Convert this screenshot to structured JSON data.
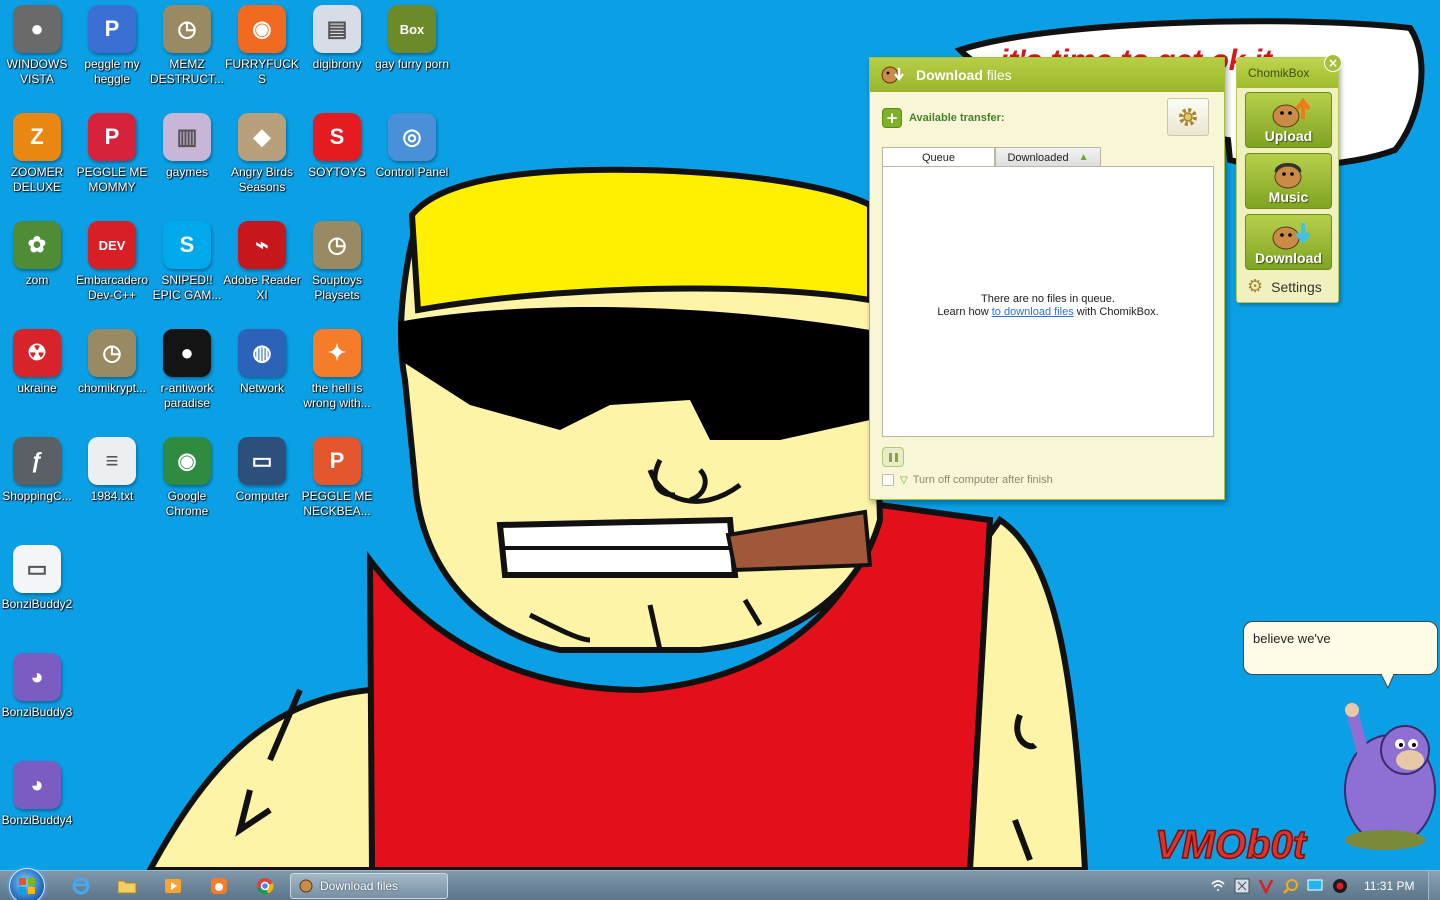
{
  "desktop_icons": [
    {
      "label": "WINDOWS VISTA",
      "icon": "windows-vista-app-icon",
      "color": "#6a6a6a",
      "glyph": "●"
    },
    {
      "label": "peggle my heggle",
      "icon": "peggle-icon",
      "color": "#3b6fd4",
      "glyph": "P"
    },
    {
      "label": "MEMZ DESTRUCT...",
      "icon": "clock-app-icon",
      "color": "#9a8a63",
      "glyph": "◷"
    },
    {
      "label": "FURRYFUCKS",
      "icon": "firefox-icon",
      "color": "#f06a1f",
      "glyph": "◉"
    },
    {
      "label": "digibrony",
      "icon": "document-app-icon",
      "color": "#d7dce6",
      "glyph": "▤"
    },
    {
      "label": "gay furry porn",
      "icon": "chomikbox-icon",
      "color": "#6c8a2a",
      "glyph": "Box"
    },
    {
      "label": "ZOOMER DELUXE",
      "icon": "zoomer-icon",
      "color": "#e88712",
      "glyph": "Z"
    },
    {
      "label": "PEGGLE ME MOMMY",
      "icon": "peggle-icon",
      "color": "#d6223a",
      "glyph": "P"
    },
    {
      "label": "gaymes",
      "icon": "folder-icon",
      "color": "#c7b6d8",
      "glyph": "▥"
    },
    {
      "label": "Angry Birds Seasons",
      "icon": "angry-birds-icon",
      "color": "#b9a07d",
      "glyph": "◆"
    },
    {
      "label": "SOYTOYS",
      "icon": "soytoys-icon",
      "color": "#e61b22",
      "glyph": "S"
    },
    {
      "label": "Control Panel",
      "icon": "control-panel-icon",
      "color": "#4a90d9",
      "glyph": "◎"
    },
    {
      "label": "zom",
      "icon": "plant-icon",
      "color": "#4f8c35",
      "glyph": "✿"
    },
    {
      "label": "Embarcadero Dev-C++",
      "icon": "dev-cpp-icon",
      "color": "#d81f26",
      "glyph": "DEV"
    },
    {
      "label": "SNIPED!! EPIC GAM...",
      "icon": "skype-icon",
      "color": "#00a9ec",
      "glyph": "S"
    },
    {
      "label": "Adobe Reader XI",
      "icon": "adobe-reader-icon",
      "color": "#c8161d",
      "glyph": "⌁"
    },
    {
      "label": "Souptoys Playsets",
      "icon": "clock-app-icon",
      "color": "#9a8a63",
      "glyph": "◷"
    },
    {
      "label": "ukraine",
      "icon": "radiation-icon",
      "color": "#d9232a",
      "glyph": "☢"
    },
    {
      "label": "chomikrypt...",
      "icon": "clock-app-icon",
      "color": "#9a8a63",
      "glyph": "◷"
    },
    {
      "label": "r-antiwork paradise",
      "icon": "antiwork-icon",
      "color": "#141414",
      "glyph": "●"
    },
    {
      "label": "Network",
      "icon": "network-icon",
      "color": "#2a63b7",
      "glyph": "◍"
    },
    {
      "label": "the hell is wrong with...",
      "icon": "uc-browser-icon",
      "color": "#f57c28",
      "glyph": "✦"
    },
    {
      "label": "ShoppingC...",
      "icon": "flash-icon",
      "color": "#5a6066",
      "glyph": "ƒ"
    },
    {
      "label": "1984.txt",
      "icon": "text-file-icon",
      "color": "#eceff2",
      "glyph": "≡"
    },
    {
      "label": "Google Chrome",
      "icon": "chrome-icon",
      "color": "#2e8b40",
      "glyph": "◉"
    },
    {
      "label": "Computer",
      "icon": "computer-icon",
      "color": "#2d4f7c",
      "glyph": "▭"
    },
    {
      "label": "PEGGLE ME NECKBEA...",
      "icon": "peggle-icon",
      "color": "#e4572e",
      "glyph": "P"
    },
    {
      "label": "BonziBuddy2",
      "icon": "shortcut-file-icon",
      "color": "#f3f5f7",
      "glyph": "▭"
    },
    {
      "label": "BonziBuddy3",
      "icon": "bonzibuddy-icon",
      "color": "#7b5cc2",
      "glyph": "◕"
    },
    {
      "label": "BonziBuddy4",
      "icon": "bonzibuddy-icon",
      "color": "#7b5cc2",
      "glyph": "◕"
    }
  ],
  "download_window": {
    "title_bold": "Download",
    "title_rest": " files",
    "available_transfer": "Available transfer:",
    "tab_queue": "Queue",
    "tab_downloaded": "Downloaded",
    "empty_line1": "There are no files in queue.",
    "empty_learn_prefix": "Learn how ",
    "empty_learn_link": "to download files",
    "empty_learn_suffix": " with ChomikBox.",
    "turn_off_label": "Turn off computer after finish",
    "accent": "#9ab52c"
  },
  "chomikbox_panel": {
    "title": "ChomikBox",
    "upload": "Upload",
    "music": "Music",
    "download": "Download",
    "settings": "Settings",
    "close": "×"
  },
  "bonzi": {
    "speech": "believe we've"
  },
  "wallpaper": {
    "banner_text": "it's time to get ok it",
    "signature": "VMOb0t"
  },
  "taskbar": {
    "active_window": "Download files",
    "clock": "11:31 PM",
    "pinned": [
      "internet-explorer-icon",
      "explorer-folder-icon",
      "media-player-icon",
      "uc-browser-icon",
      "chrome-icon"
    ],
    "tray": [
      "wifi-tray-icon",
      "ime-tray-icon",
      "antivirus-tray-icon",
      "search-tray-icon",
      "display-tray-icon",
      "record-tray-icon"
    ]
  }
}
